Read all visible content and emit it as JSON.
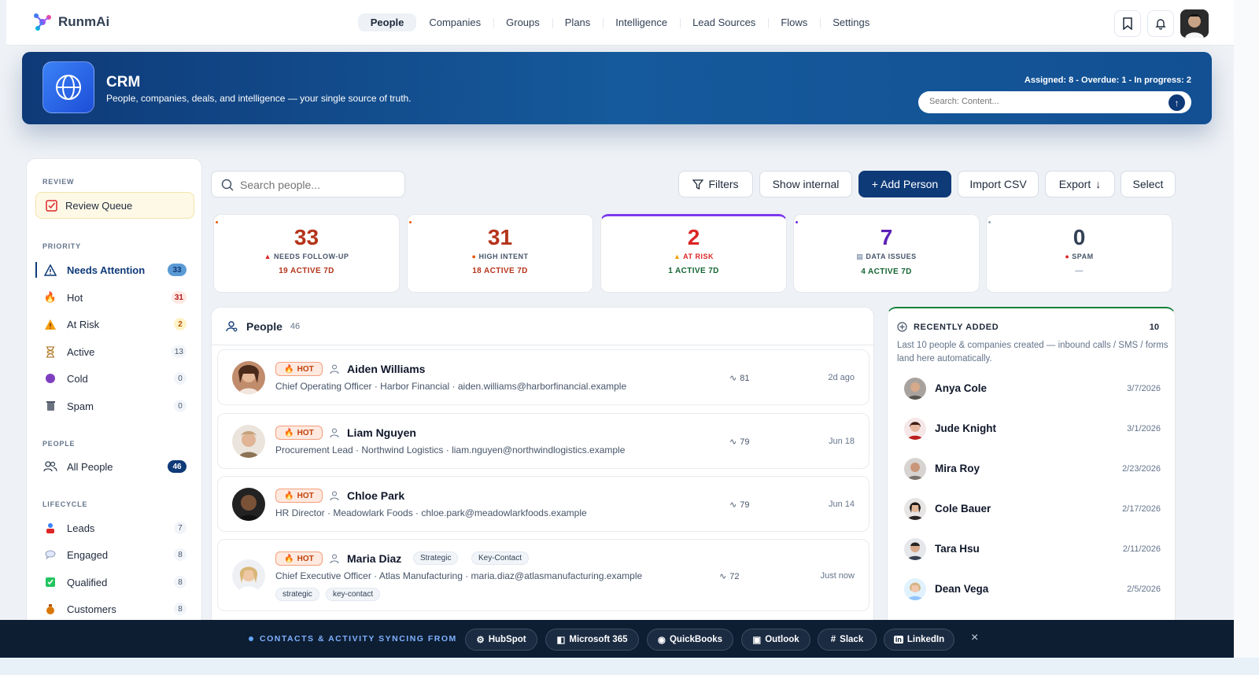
{
  "app": {
    "name": "RunmAi"
  },
  "nav": {
    "items": [
      "People",
      "Companies",
      "Groups",
      "Plans",
      "Intelligence",
      "Lead Sources",
      "Flows",
      "Settings"
    ],
    "active": "People"
  },
  "hero": {
    "title": "CRM",
    "subtitle": "People, companies, deals, and intelligence — your single source of truth.",
    "stats": "Assigned: 8 - Overdue: 1 - In progress: 2",
    "search_placeholder": "Search: Content..."
  },
  "sidebar": {
    "review_label": "REVIEW",
    "review_queue": "Review Queue",
    "priority_label": "PRIORITY",
    "priority": [
      {
        "label": "Needs Attention",
        "count": "33"
      },
      {
        "label": "Hot",
        "count": "31"
      },
      {
        "label": "At Risk",
        "count": "2"
      },
      {
        "label": "Active",
        "count": "13"
      },
      {
        "label": "Cold",
        "count": "0"
      },
      {
        "label": "Spam",
        "count": "0"
      }
    ],
    "people_label": "PEOPLE",
    "all_people": {
      "label": "All People",
      "count": "46"
    },
    "lifecycle_label": "LIFECYCLE",
    "lifecycle": [
      {
        "label": "Leads",
        "count": "7"
      },
      {
        "label": "Engaged",
        "count": "8"
      },
      {
        "label": "Qualified",
        "count": "8"
      },
      {
        "label": "Customers",
        "count": "8"
      }
    ]
  },
  "toolbar": {
    "search_placeholder": "Search people...",
    "filters": "Filters",
    "show_internal": "Show internal",
    "add_person": "+ Add Person",
    "import_csv": "Import CSV",
    "export": "Export",
    "select": "Select"
  },
  "stats": [
    {
      "num": "33",
      "label": "NEEDS FOLLOW-UP",
      "active": "19 ACTIVE 7D",
      "color": "#b5341b"
    },
    {
      "num": "31",
      "label": "HIGH INTENT",
      "active": "18 ACTIVE 7D",
      "color": "#b5341b"
    },
    {
      "num": "2",
      "label": "AT RISK",
      "active": "1 ACTIVE 7D",
      "color": "#dc2626"
    },
    {
      "num": "7",
      "label": "DATA ISSUES",
      "active": "4 ACTIVE 7D",
      "color": "#5b21b6"
    },
    {
      "num": "0",
      "label": "SPAM",
      "active": "—",
      "color": "#334155"
    }
  ],
  "people": {
    "title": "People",
    "count": "46",
    "hot_label": "HOT",
    "rows": [
      {
        "name": "Aiden Williams",
        "sub": "Chief Operating Officer · Harbor Financial · aiden.williams@harborfinancial.example",
        "score": "81",
        "date": "2d ago"
      },
      {
        "name": "Liam Nguyen",
        "sub": "Procurement Lead · Northwind Logistics · liam.nguyen@northwindlogistics.example",
        "score": "79",
        "date": "Jun 18"
      },
      {
        "name": "Chloe Park",
        "sub": "HR Director · Meadowlark Foods · chloe.park@meadowlarkfoods.example",
        "score": "79",
        "date": "Jun 14"
      },
      {
        "name": "Maria Diaz",
        "sub": "Chief Executive Officer · Atlas Manufacturing · maria.diaz@atlasmanufacturing.example",
        "score": "72",
        "date": "Just now",
        "tags": [
          "Strategic",
          "Key-Contact"
        ],
        "subtags": [
          "strategic",
          "key-contact"
        ]
      }
    ]
  },
  "recent": {
    "title": "RECENTLY ADDED",
    "count": "10",
    "desc": "Last 10 people & companies created — inbound calls / SMS / forms land here automatically.",
    "rows": [
      {
        "name": "Anya Cole",
        "date": "3/7/2026"
      },
      {
        "name": "Jude Knight",
        "date": "3/1/2026"
      },
      {
        "name": "Mira Roy",
        "date": "2/23/2026"
      },
      {
        "name": "Cole Bauer",
        "date": "2/17/2026"
      },
      {
        "name": "Tara Hsu",
        "date": "2/11/2026"
      },
      {
        "name": "Dean Vega",
        "date": "2/5/2026"
      }
    ]
  },
  "sync": {
    "label": "CONTACTS & ACTIVITY SYNCING FROM",
    "sources": [
      "HubSpot",
      "Microsoft 365",
      "QuickBooks",
      "Outlook",
      "Slack",
      "LinkedIn"
    ]
  },
  "colors": {
    "brand": "#0f3a78",
    "hot": "#c2410c",
    "recent_accent": "#15803d"
  }
}
